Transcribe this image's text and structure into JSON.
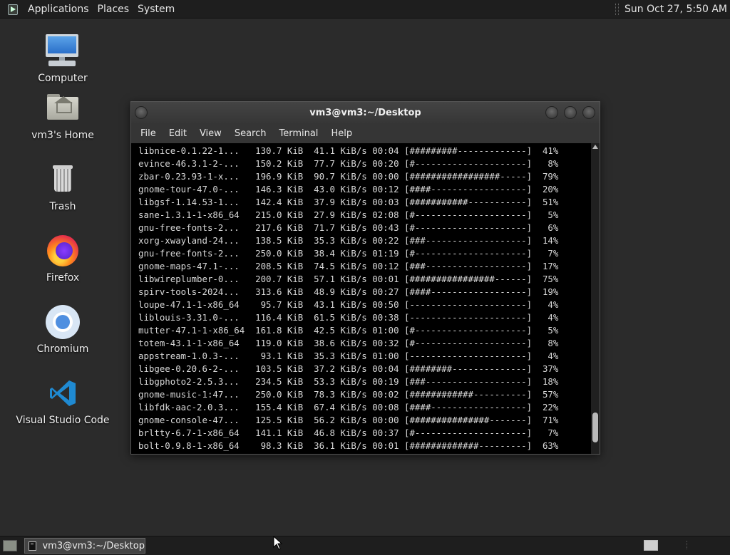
{
  "top_panel": {
    "menus": [
      "Applications",
      "Places",
      "System"
    ],
    "clock": "Sun Oct 27,  5:50 AM"
  },
  "desktop_icons": [
    {
      "label": "Computer",
      "icon": "computer-icon"
    },
    {
      "label": "vm3's Home",
      "icon": "home-folder-icon"
    },
    {
      "label": "Trash",
      "icon": "trash-icon"
    },
    {
      "label": "Firefox",
      "icon": "firefox-icon"
    },
    {
      "label": "Chromium",
      "icon": "chromium-icon"
    },
    {
      "label": "Visual Studio Code",
      "icon": "vscode-icon"
    }
  ],
  "terminal": {
    "title": "vm3@vm3:~/Desktop",
    "menus": [
      "File",
      "Edit",
      "View",
      "Search",
      "Terminal",
      "Help"
    ],
    "lines": [
      "libnice-0.1.22-1...   130.7 KiB  41.1 KiB/s 00:04 [#########-------------]  41%",
      "evince-46.3.1-2-...   150.2 KiB  77.7 KiB/s 00:20 [#---------------------]   8%",
      "zbar-0.23.93-1-x...   196.9 KiB  90.7 KiB/s 00:00 [#################-----]  79%",
      "gnome-tour-47.0-...   146.3 KiB  43.0 KiB/s 00:12 [####------------------]  20%",
      "libgsf-1.14.53-1...   142.4 KiB  37.9 KiB/s 00:03 [###########-----------]  51%",
      "sane-1.3.1-1-x86_64   215.0 KiB  27.9 KiB/s 02:08 [#---------------------]   5%",
      "gnu-free-fonts-2...   217.6 KiB  71.7 KiB/s 00:43 [#---------------------]   6%",
      "xorg-xwayland-24...   138.5 KiB  35.3 KiB/s 00:22 [###-------------------]  14%",
      "gnu-free-fonts-2...   250.0 KiB  38.4 KiB/s 01:19 [#---------------------]   7%",
      "gnome-maps-47.1-...   208.5 KiB  74.5 KiB/s 00:12 [###-------------------]  17%",
      "libwireplumber-0...   200.7 KiB  57.1 KiB/s 00:01 [################------]  75%",
      "spirv-tools-2024...   313.6 KiB  48.9 KiB/s 00:27 [####------------------]  19%",
      "loupe-47.1-1-x86_64    95.7 KiB  43.1 KiB/s 00:50 [----------------------]   4%",
      "liblouis-3.31.0-...   116.4 KiB  61.5 KiB/s 00:38 [----------------------]   4%",
      "mutter-47.1-1-x86_64  161.8 KiB  42.5 KiB/s 01:00 [#---------------------]   5%",
      "totem-43.1-1-x86_64   119.0 KiB  38.6 KiB/s 00:32 [#---------------------]   8%",
      "appstream-1.0.3-...    93.1 KiB  35.3 KiB/s 01:00 [----------------------]   4%",
      "libgee-0.20.6-2-...   103.5 KiB  37.2 KiB/s 00:04 [########--------------]  37%",
      "libgphoto2-2.5.3...   234.5 KiB  53.3 KiB/s 00:19 [###-------------------]  18%",
      "gnome-music-1:47...   250.0 KiB  78.3 KiB/s 00:02 [############----------]  57%",
      "libfdk-aac-2.0.3...   155.4 KiB  67.4 KiB/s 00:08 [####------------------]  22%",
      "gnome-console-47...   125.5 KiB  56.2 KiB/s 00:00 [###############-------]  71%",
      "brltty-6.7-1-x86_64   141.1 KiB  46.8 KiB/s 00:37 [#---------------------]   7%",
      "bolt-0.9.8-1-x86_64    98.3 KiB  36.1 KiB/s 00:01 [#############---------]  63%"
    ]
  },
  "taskbar": {
    "window_label": "vm3@vm3:~/Desktop"
  }
}
